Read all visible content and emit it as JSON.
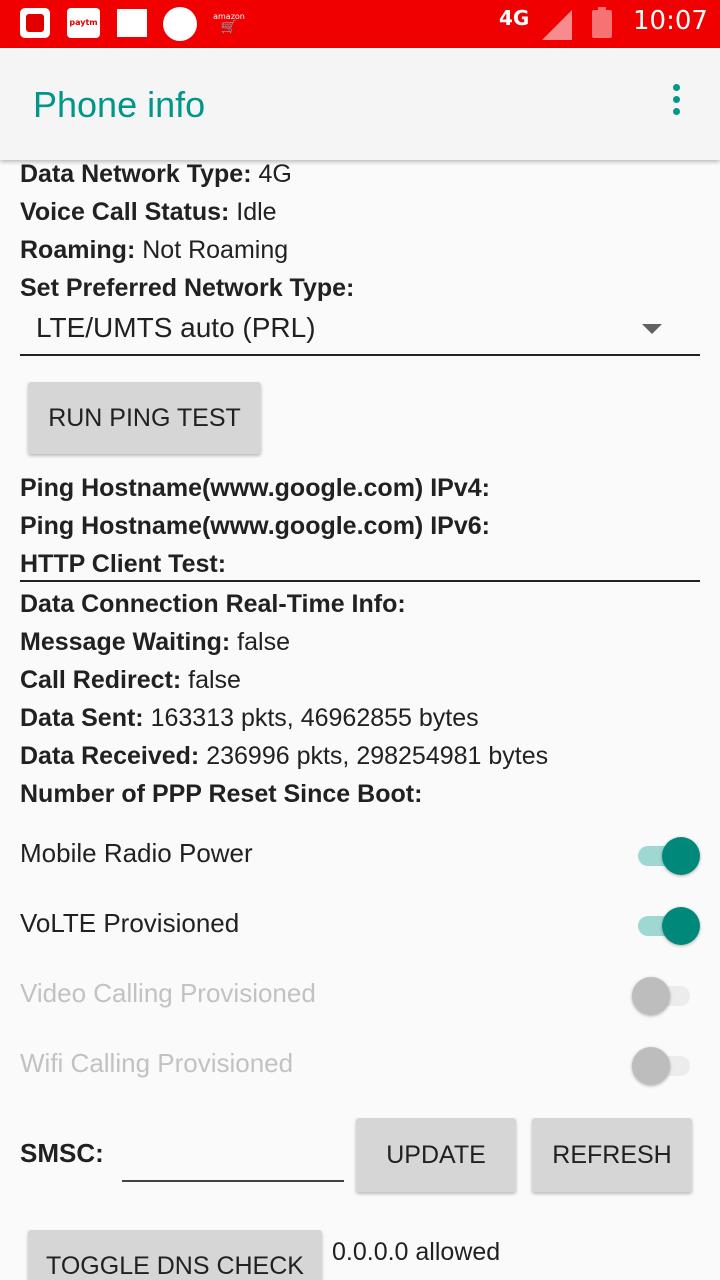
{
  "status_bar": {
    "icons": [
      "saavn-icon",
      "paytm-icon",
      "notification-square-icon",
      "notification-circle-icon",
      "amazon-icon"
    ],
    "paytm_text": "paytm",
    "amazon_text": "amazon",
    "network": "4G",
    "time": "10:07"
  },
  "app_bar": {
    "title": "Phone info",
    "menu_icon": "more-vert-icon"
  },
  "info": {
    "data_network_type": {
      "label": "Data Network Type:",
      "value": "4G"
    },
    "voice_call_status": {
      "label": "Voice Call Status:",
      "value": "Idle"
    },
    "roaming": {
      "label": "Roaming:",
      "value": "Not Roaming"
    },
    "preferred_network_label": "Set Preferred Network Type:",
    "preferred_network_value": "LTE/UMTS auto (PRL)"
  },
  "ping": {
    "button_label": "RUN PING TEST",
    "ipv4_label": "Ping Hostname(www.google.com) IPv4:",
    "ipv6_label": "Ping Hostname(www.google.com) IPv6:",
    "http_label": "HTTP Client Test:"
  },
  "connection": {
    "realtime_label": "Data Connection Real-Time Info:",
    "message_waiting": {
      "label": "Message Waiting:",
      "value": "false"
    },
    "call_redirect": {
      "label": "Call Redirect:",
      "value": "false"
    },
    "data_sent": {
      "label": "Data Sent:",
      "value": "163313 pkts, 46962855 bytes"
    },
    "data_received": {
      "label": "Data Received:",
      "value": "236996 pkts, 298254981 bytes"
    },
    "ppp_reset_label": "Number of PPP Reset Since Boot:"
  },
  "switches": [
    {
      "label": "Mobile Radio Power",
      "on": true,
      "enabled": true
    },
    {
      "label": "VoLTE Provisioned",
      "on": true,
      "enabled": true
    },
    {
      "label": "Video Calling Provisioned",
      "on": false,
      "enabled": false
    },
    {
      "label": "Wifi Calling Provisioned",
      "on": false,
      "enabled": false
    }
  ],
  "smsc": {
    "label": "SMSC:",
    "value": "",
    "update_label": "UPDATE",
    "refresh_label": "REFRESH"
  },
  "dns": {
    "button_label": "TOGGLE DNS CHECK",
    "status": "0.0.0.0 allowed"
  }
}
